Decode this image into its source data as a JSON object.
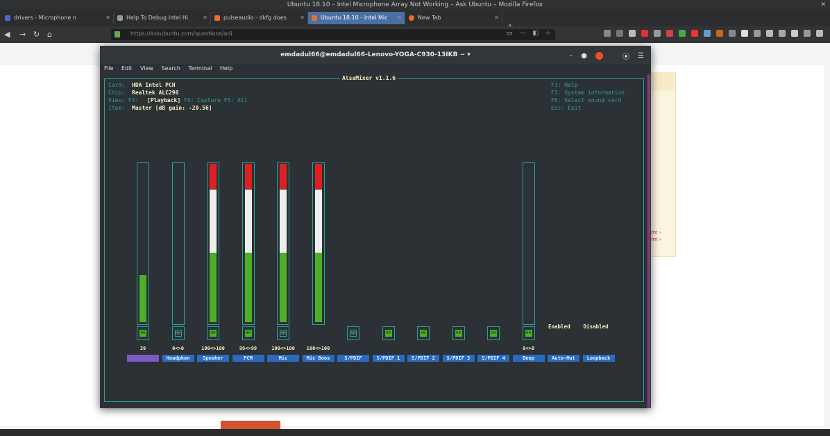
{
  "browser": {
    "window_title": "Ubuntu 18.10 – Intel Microphone Array Not Working – Ask Ubuntu – Mozilla Firefox",
    "tabs": [
      {
        "label": "drivers - Microphone n",
        "color": "#5865c9"
      },
      {
        "label": "Help To Debug Intel Hi",
        "color": "#999999"
      },
      {
        "label": "pulseaudio - dkfg does",
        "color": "#e8702a"
      },
      {
        "label": "Ubuntu 18.10 - Intel Mic",
        "color": "#e8702a",
        "active": true
      },
      {
        "label": "New Tab",
        "color": "#e8702a"
      }
    ],
    "new_tab": "+",
    "url": "https://askubuntu.com/questions/adi",
    "colors": {
      "accent": "#4a6fa5",
      "ubuntu_orange": "#e95420"
    }
  },
  "terminal": {
    "title": "emdadul66@emdadul66-Lenovo-YOGA-C930-13IKB ~",
    "menu": [
      "File",
      "Edit",
      "View",
      "Search",
      "Terminal",
      "Help"
    ]
  },
  "alsamixer": {
    "title": "AlsaMixer v1.1.6",
    "info": [
      {
        "key": "Card:",
        "value": "HDA Intel PCH",
        "extra": ""
      },
      {
        "key": "Chip:",
        "value": "Realtek ALC298",
        "extra": ""
      },
      {
        "key": "View: F3:",
        "value": "[Playback]",
        "extra": "F4: Capture  F5: All"
      },
      {
        "key": "Item:",
        "value": "Master [dB gain: -20.56]",
        "extra": ""
      }
    ],
    "fkeys": [
      "F1:  Help",
      "F2:  System information",
      "F6:  Select sound card",
      "Esc: Exit"
    ],
    "channels": [
      {
        "label": "",
        "value": "39",
        "level": 0.3,
        "mute": "00",
        "selected": true,
        "has_bar": true
      },
      {
        "label": "Headphon",
        "value": "0<>0",
        "level": 0,
        "mute": "MM",
        "has_bar": true
      },
      {
        "label": "Speaker",
        "value": "100<>100",
        "level": 1.0,
        "mute": "00",
        "has_bar": true
      },
      {
        "label": "PCM",
        "value": "99<>99",
        "level": 1.0,
        "mute": "00",
        "has_bar": true
      },
      {
        "label": "Mic",
        "value": "100<>100",
        "level": 1.0,
        "mute": "MM",
        "has_bar": true
      },
      {
        "label": "Mic Boos",
        "value": "100<>100",
        "level": 1.0,
        "mute": "",
        "has_bar": true
      },
      {
        "label": "S/PDIF",
        "value": "",
        "level": 0,
        "mute": "MM",
        "has_bar": false
      },
      {
        "label": "S/PDIF 1",
        "value": "",
        "level": 0,
        "mute": "00",
        "has_bar": false
      },
      {
        "label": "S/PDIF 2",
        "value": "",
        "level": 0,
        "mute": "00",
        "has_bar": false
      },
      {
        "label": "S/PDIF 3",
        "value": "",
        "level": 0,
        "mute": "00",
        "has_bar": false
      },
      {
        "label": "S/PDIF 4",
        "value": "",
        "level": 0,
        "mute": "00",
        "has_bar": false
      },
      {
        "label": "Beep",
        "value": "0<>0",
        "level": 0,
        "mute": "00",
        "has_bar": true
      },
      {
        "label": "Auto-Mut",
        "value": "",
        "enum": "Enabled",
        "has_bar": false
      },
      {
        "label": "Loopback",
        "value": "",
        "enum": "Disabled",
        "has_bar": false
      }
    ],
    "colors": {
      "green": "#4caf27",
      "white": "#eeeeee",
      "red": "#e02020",
      "frame": "#2aa198"
    }
  },
  "background_page": {
    "links": [
      "rm ›",
      "rm ›"
    ]
  }
}
